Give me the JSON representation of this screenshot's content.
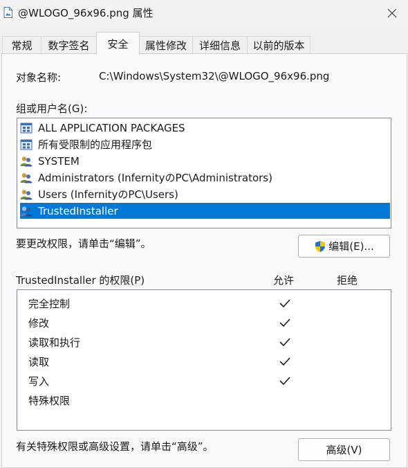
{
  "window": {
    "title": "@WLOGO_96x96.png 属性"
  },
  "tabs": [
    {
      "label": "常规"
    },
    {
      "label": "数字签名"
    },
    {
      "label": "安全",
      "active": true
    },
    {
      "label": "属性修改"
    },
    {
      "label": "详细信息"
    },
    {
      "label": "以前的版本"
    }
  ],
  "security": {
    "object_name_label": "对象名称:",
    "object_name_value": "C:\\Windows\\System32\\@WLOGO_96x96.png",
    "groups_label": "组或用户名(G):",
    "groups": [
      {
        "label": "ALL APPLICATION PACKAGES",
        "icon": "app-package-icon"
      },
      {
        "label": "所有受限制的应用程序包",
        "icon": "app-package-icon"
      },
      {
        "label": "SYSTEM",
        "icon": "users-icon"
      },
      {
        "label": "Administrators (InfernityのPC\\Administrators)",
        "icon": "users-icon"
      },
      {
        "label": "Users (InfernityのPC\\Users)",
        "icon": "users-icon"
      },
      {
        "label": "TrustedInstaller",
        "icon": "users-icon",
        "selected": true
      }
    ],
    "edit_hint": "要更改权限，请单击“编辑”。",
    "edit_button": "编辑(E)...",
    "permissions_label": "TrustedInstaller 的权限(P)",
    "allow_header": "允许",
    "deny_header": "拒绝",
    "permissions": [
      {
        "name": "完全控制",
        "allow": true,
        "deny": false
      },
      {
        "name": "修改",
        "allow": true,
        "deny": false
      },
      {
        "name": "读取和执行",
        "allow": true,
        "deny": false
      },
      {
        "name": "读取",
        "allow": true,
        "deny": false
      },
      {
        "name": "写入",
        "allow": true,
        "deny": false
      },
      {
        "name": "特殊权限",
        "allow": false,
        "deny": false
      }
    ],
    "advanced_hint": "有关特殊权限或高级设置，请单击“高级”。",
    "advanced_button": "高级(V)"
  },
  "colors": {
    "selection": "#0078d7",
    "shield_blue": "#1f6fd1",
    "shield_yellow": "#f5c400"
  }
}
